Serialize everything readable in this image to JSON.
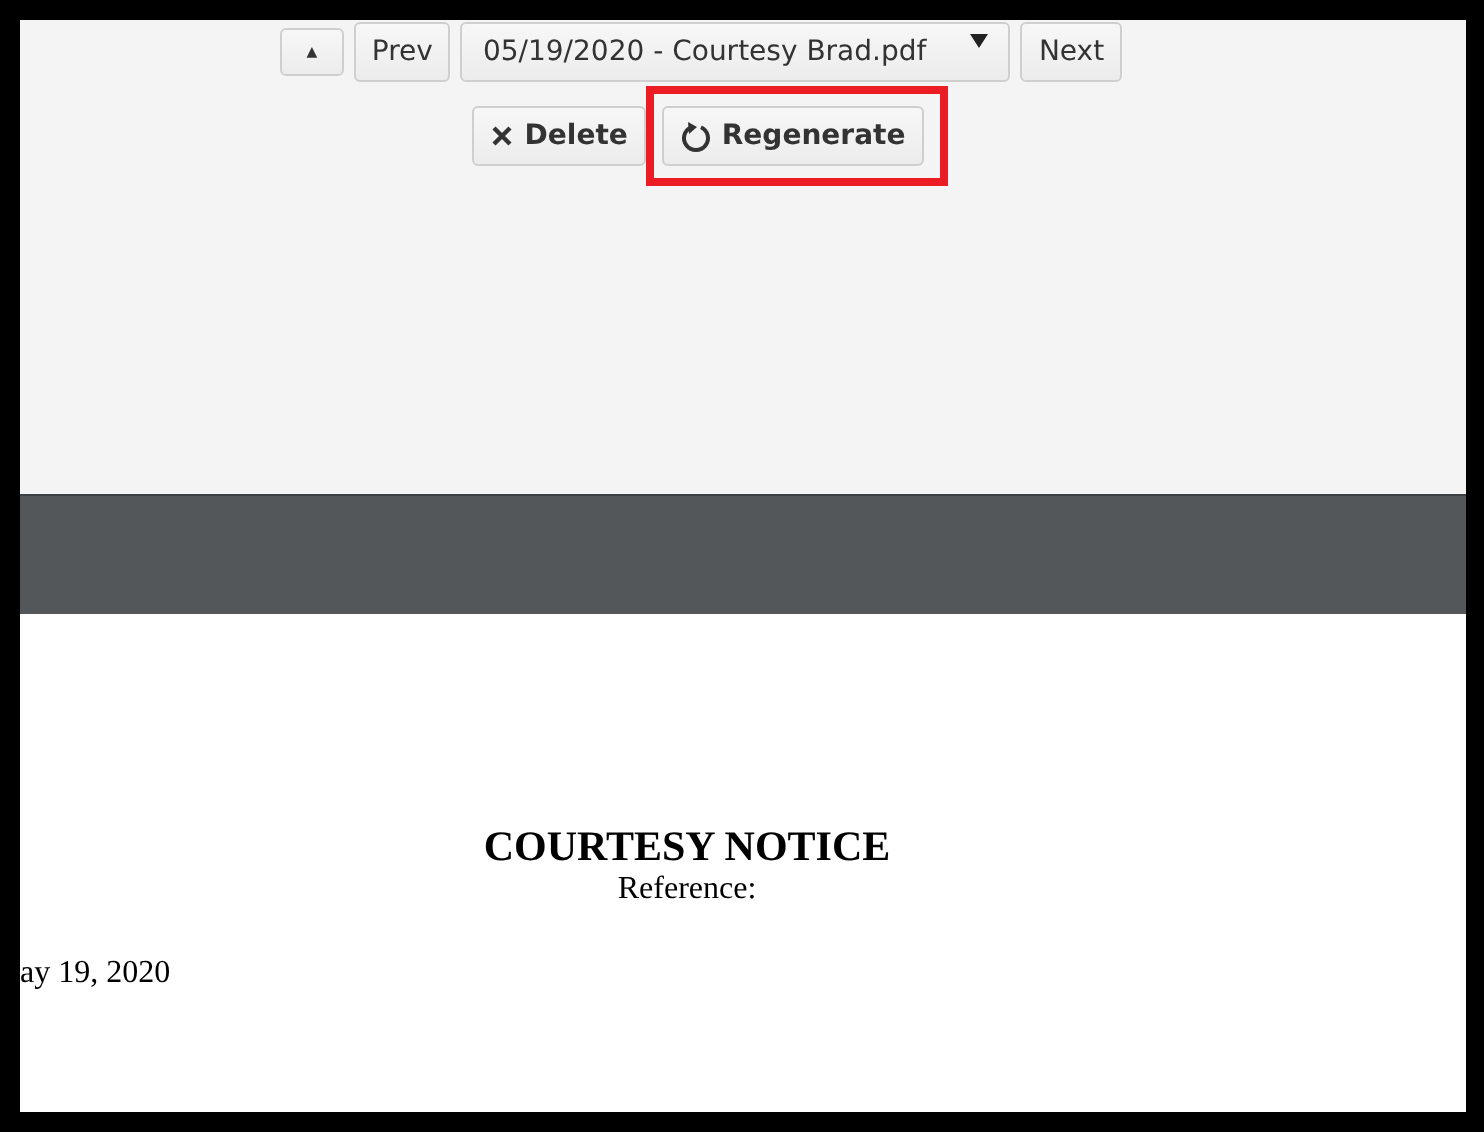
{
  "toolbar": {
    "collapse_button": {
      "icon": "▲"
    },
    "prev_button": "Prev",
    "file_select": {
      "value": "05/19/2020 - Courtesy Brad.pdf"
    },
    "next_button": "Next"
  },
  "actions": [
    {
      "label": "Delete",
      "kind": "delete",
      "highlighted": false
    },
    {
      "label": "Regenerate",
      "kind": "regenerate",
      "highlighted": true
    }
  ],
  "document": {
    "title": "COURTESY NOTICE",
    "subtitle": "Reference:",
    "date": "ay 19, 2020"
  }
}
